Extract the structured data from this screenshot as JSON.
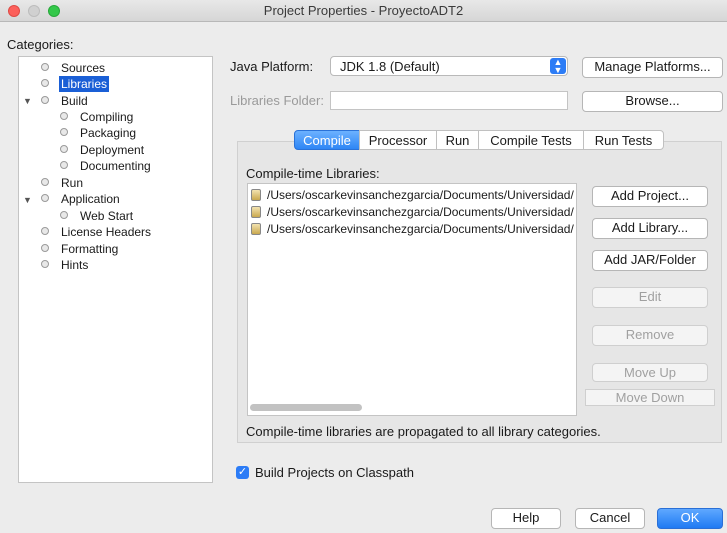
{
  "window": {
    "title": "Project Properties - ProyectoADT2"
  },
  "categories": {
    "label": "Categories:",
    "items": [
      {
        "label": "Sources"
      },
      {
        "label": "Libraries"
      },
      {
        "label": "Build"
      },
      {
        "label": "Compiling"
      },
      {
        "label": "Packaging"
      },
      {
        "label": "Deployment"
      },
      {
        "label": "Documenting"
      },
      {
        "label": "Run"
      },
      {
        "label": "Application"
      },
      {
        "label": "Web Start"
      },
      {
        "label": "License Headers"
      },
      {
        "label": "Formatting"
      },
      {
        "label": "Hints"
      }
    ],
    "selected": "Libraries"
  },
  "platform": {
    "label": "Java Platform:",
    "value": "JDK 1.8 (Default)",
    "manage_button": "Manage Platforms..."
  },
  "libraries_folder": {
    "label": "Libraries Folder:",
    "value": "",
    "browse_button": "Browse..."
  },
  "tabs": [
    {
      "label": "Compile"
    },
    {
      "label": "Processor"
    },
    {
      "label": "Run"
    },
    {
      "label": "Compile Tests"
    },
    {
      "label": "Run Tests"
    }
  ],
  "active_tab": "Compile",
  "compile": {
    "list_label": "Compile-time Libraries:",
    "libraries": [
      {
        "path": "/Users/oscarkevinsanchezgarcia/Documents/Universidad/"
      },
      {
        "path": "/Users/oscarkevinsanchezgarcia/Documents/Universidad/"
      },
      {
        "path": "/Users/oscarkevinsanchezgarcia/Documents/Universidad/"
      }
    ],
    "buttons": {
      "add_project": "Add Project...",
      "add_library": "Add Library...",
      "add_jar": "Add JAR/Folder",
      "edit": "Edit",
      "remove": "Remove",
      "move_up": "Move Up",
      "move_down": "Move Down"
    },
    "note": "Compile-time libraries are propagated to all library categories."
  },
  "build_on_classpath": {
    "label": "Build Projects on Classpath",
    "checked": true
  },
  "footer": {
    "help": "Help",
    "cancel": "Cancel",
    "ok": "OK"
  },
  "colors": {
    "accent": "#2c7cf6",
    "selection": "#1a5fd6"
  }
}
